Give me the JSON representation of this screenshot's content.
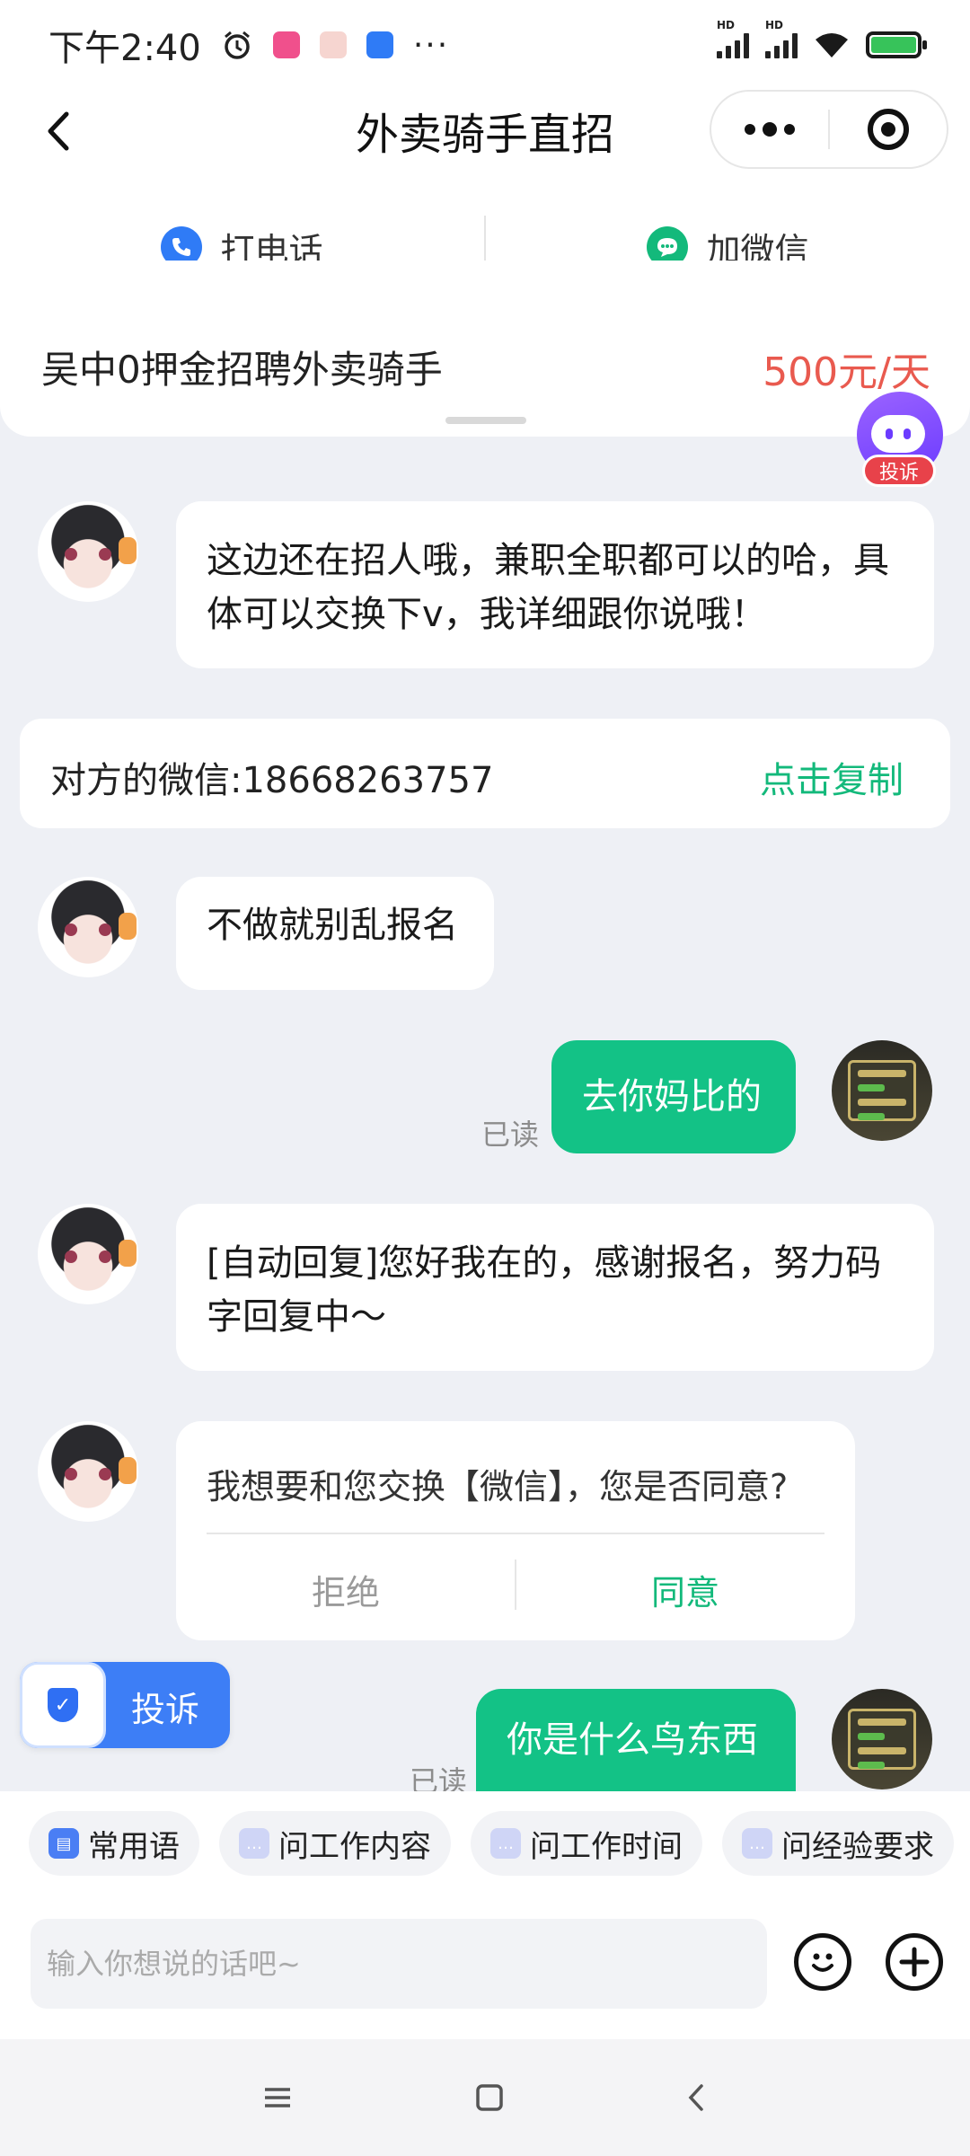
{
  "status_bar": {
    "time": "下午2:40",
    "more": "···",
    "hd1": "HD",
    "hd2": "HD"
  },
  "header": {
    "title": "外卖骑手直招",
    "call_label": "打电话",
    "wechat_label": "加微信"
  },
  "job": {
    "title": "吴中0押金招聘外卖骑手",
    "salary": "500元/天"
  },
  "bot": {
    "tag": "投诉"
  },
  "messages": {
    "m1": "这边还在招人哦，兼职全职都可以的哈，具体可以交换下v，我详细跟你说哦！",
    "m2": "不做就别乱报名",
    "m3": "去你妈比的",
    "m4": "[自动回复]您好我在的，感谢报名，努力码字回复中～",
    "m5": "你是什么鸟东西",
    "read": "已读"
  },
  "wechat_card": {
    "label": "对方的微信:18668263757",
    "copy": "点击复制"
  },
  "exchange": {
    "question": "我想要和您交换【微信】，您是否同意?",
    "refuse": "拒绝",
    "agree": "同意"
  },
  "report_float": {
    "label": "投诉"
  },
  "chips": [
    "常用语",
    "问工作内容",
    "问工作时间",
    "问经验要求"
  ],
  "input": {
    "placeholder": "输入你想说的话吧~"
  },
  "colors": {
    "accent": "#13c286",
    "salary": "#e95a4f",
    "report": "#3d7ef6"
  }
}
